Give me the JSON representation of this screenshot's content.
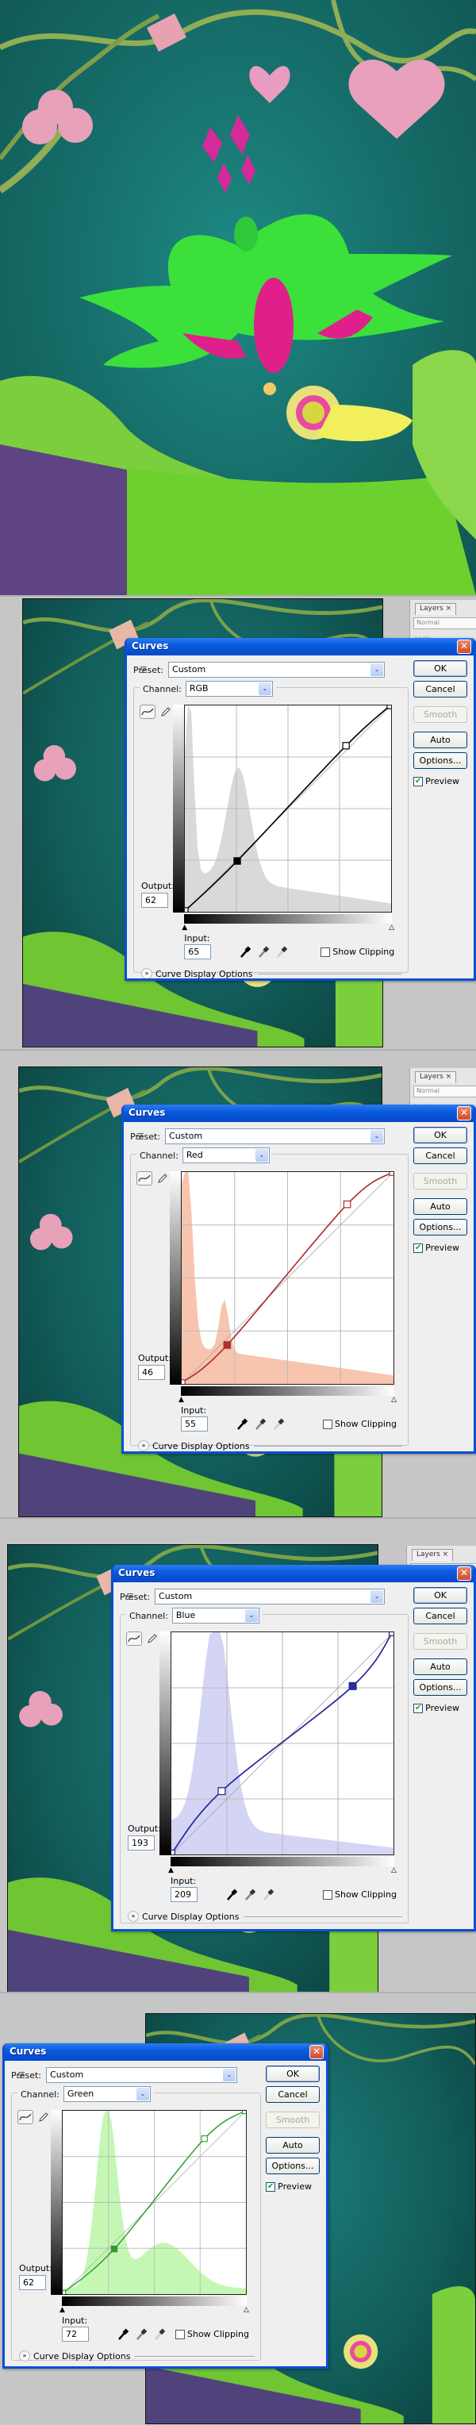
{
  "dialog_common": {
    "title": "Curves",
    "preset_label": "Preset:",
    "preset_value": "Custom",
    "channel_label": "Channel:",
    "buttons": {
      "ok": "OK",
      "cancel": "Cancel",
      "smooth": "Smooth",
      "auto": "Auto",
      "options": "Options..."
    },
    "preview_label": "Preview",
    "preview_checked": true,
    "output_label": "Output:",
    "input_label": "Input:",
    "show_clipping_label": "Show Clipping",
    "show_clipping_checked": false,
    "curve_display_options_label": "Curve Display Options",
    "close_glyph": "✕",
    "dropdown_glyph": "⌄",
    "expand_glyph": "»"
  },
  "layers_panel": {
    "tab_label": "Layers ×",
    "blend_mode": "Normal",
    "lock_label": "Lock:"
  },
  "panels": [
    {
      "channel": "RGB",
      "output": "62",
      "input": "65",
      "curve_color": "#000000",
      "hist_color": "#d9d9d9",
      "points": [
        [
          0,
          0
        ],
        [
          65,
          62
        ],
        [
          200,
          205
        ],
        [
          255,
          255
        ]
      ]
    },
    {
      "channel": "Red",
      "output": "46",
      "input": "55",
      "curve_color": "#b03030",
      "hist_color": "#f7c4ae",
      "points": [
        [
          0,
          0
        ],
        [
          55,
          46
        ],
        [
          200,
          216
        ],
        [
          255,
          255
        ]
      ]
    },
    {
      "channel": "Blue",
      "output": "193",
      "input": "209",
      "curve_color": "#2a2a9a",
      "hist_color": "#d4d4f4",
      "points": [
        [
          0,
          0
        ],
        [
          58,
          72
        ],
        [
          209,
          193
        ],
        [
          255,
          255
        ]
      ]
    },
    {
      "channel": "Green",
      "output": "62",
      "input": "72",
      "curve_color": "#2f9a2f",
      "hist_color": "#c4f7b4",
      "points": [
        [
          0,
          0
        ],
        [
          72,
          62
        ],
        [
          198,
          216
        ],
        [
          255,
          255
        ]
      ]
    }
  ],
  "colors": {
    "xp_title_blue": "#0b5bde",
    "dialog_bg": "#efefef",
    "workspace_gray": "#c6c6c6",
    "art_teal": "#17706c"
  }
}
